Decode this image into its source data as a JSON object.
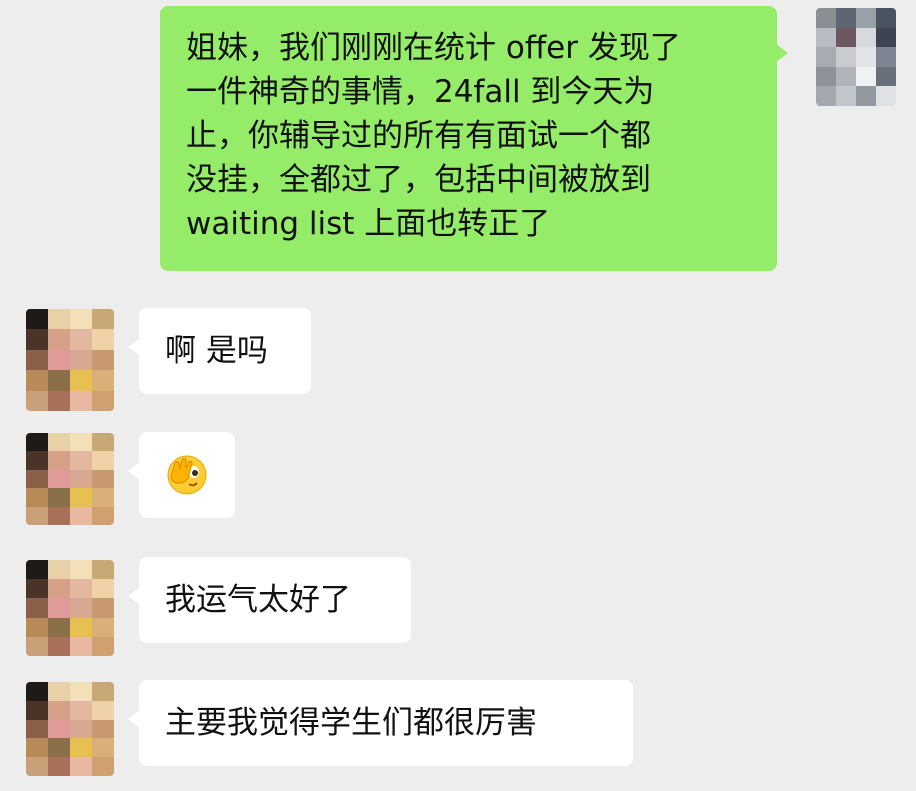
{
  "chat": {
    "messages": [
      {
        "sender": "self",
        "text": "姐妹，我们刚刚在统计 offer 发现了\n一件神奇的事情，24fall 到今天为\n止，你辅导过的所有有面试一个都\n没挂，全都过了，包括中间被放到\nwaiting list 上面也转正了"
      },
      {
        "sender": "peer",
        "text": "啊 是吗"
      },
      {
        "sender": "peer",
        "emoji": "face-with-hand-over-eye-emoji"
      },
      {
        "sender": "peer",
        "text": "我运气太好了"
      },
      {
        "sender": "peer",
        "text": "主要我觉得学生们都很厉害"
      }
    ]
  },
  "colors": {
    "background": "#ededed",
    "outgoing_bubble": "#95ec69",
    "incoming_bubble": "#ffffff",
    "text": "#111111"
  }
}
